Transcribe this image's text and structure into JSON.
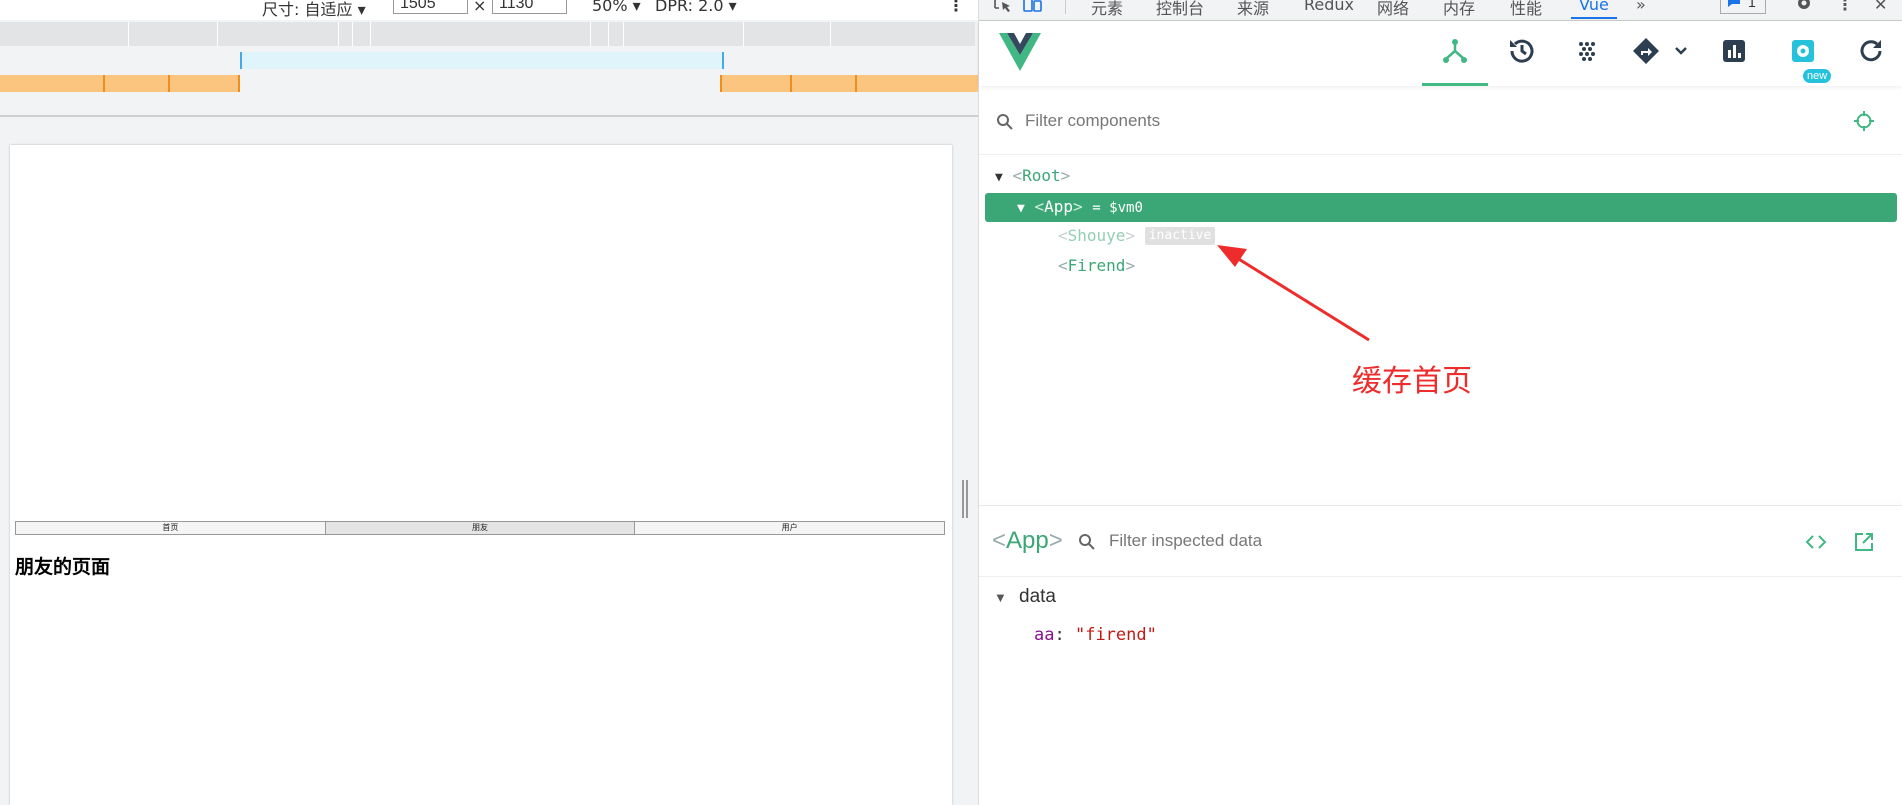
{
  "devtools_toolbar": {
    "size_label": "尺寸: 自适应",
    "width": "1505",
    "times": "×",
    "height": "1130",
    "zoom": "50%",
    "dpr": "DPR: 2.0"
  },
  "page": {
    "tabs": [
      {
        "label": "首页"
      },
      {
        "label": "朋友"
      },
      {
        "label": "用户"
      }
    ],
    "heading": "朋友的页面"
  },
  "devtools_tabs": [
    "元素",
    "控制台",
    "来源",
    "Redux",
    "网络",
    "内存",
    "性能",
    "Vue"
  ],
  "devtools_tabs_more": "»",
  "devtools_chat_count": "1",
  "vue": {
    "new_badge": "new",
    "filter_components_placeholder": "Filter components",
    "tree": {
      "root": "Root",
      "app": "App",
      "app_suffix": "= $vm0",
      "shouye": "Shouye",
      "inactive": "inactive",
      "firend": "Firend"
    },
    "annotation": "缓存首页",
    "inspector": {
      "title": "App",
      "filter_placeholder": "Filter inspected data",
      "section": "data",
      "key": "aa",
      "value": "\"firend\""
    }
  },
  "colors": {
    "vue_green": "#3ba776",
    "annotation_red": "#ee2c2c",
    "string_red": "#c41a16",
    "key_purple": "#881391"
  }
}
